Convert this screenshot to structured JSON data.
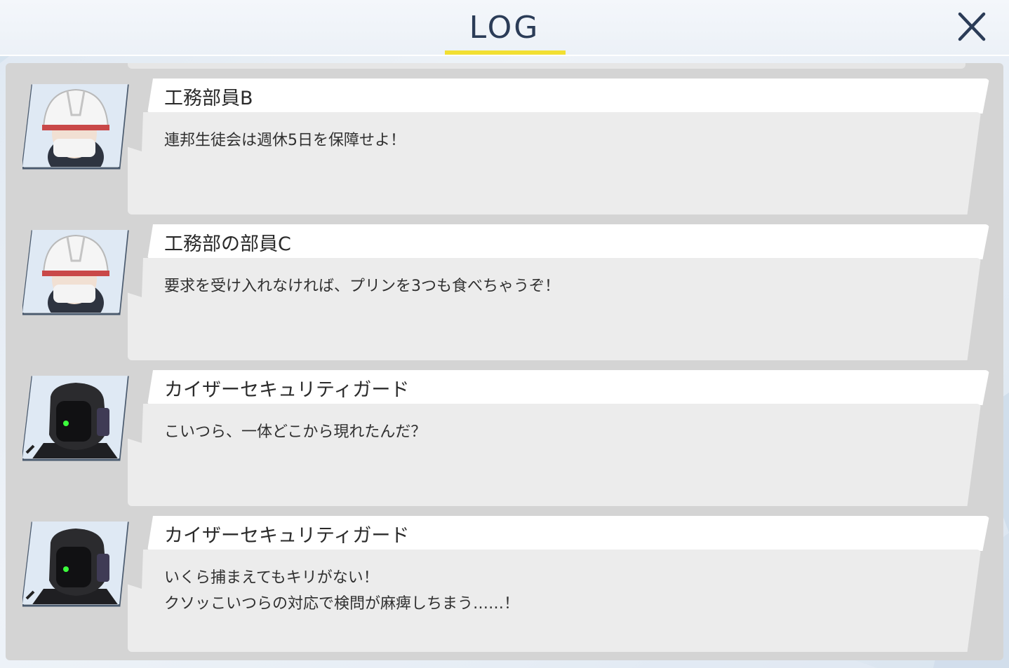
{
  "header": {
    "title": "LOG",
    "accent_color": "#f2df32",
    "close_icon": "close-icon"
  },
  "log": {
    "entries": [
      {
        "speaker": "工務部員B",
        "portrait": "helmet-mask-portrait",
        "message": "連邦生徒会は週休5日を保障せよ！"
      },
      {
        "speaker": "工務部の部員C",
        "portrait": "helmet-mask-portrait",
        "message": "要求を受け入れなければ、プリンを3つも食べちゃうぞ！"
      },
      {
        "speaker": "カイザーセキュリティガード",
        "portrait": "robot-guard-portrait",
        "message": "こいつら、一体どこから現れたんだ？"
      },
      {
        "speaker": "カイザーセキュリティガード",
        "portrait": "robot-guard-portrait",
        "message": "いくら捕まえてもキリがない！\nクソッこいつらの対応で検問が麻痺しちまう……！"
      }
    ]
  }
}
